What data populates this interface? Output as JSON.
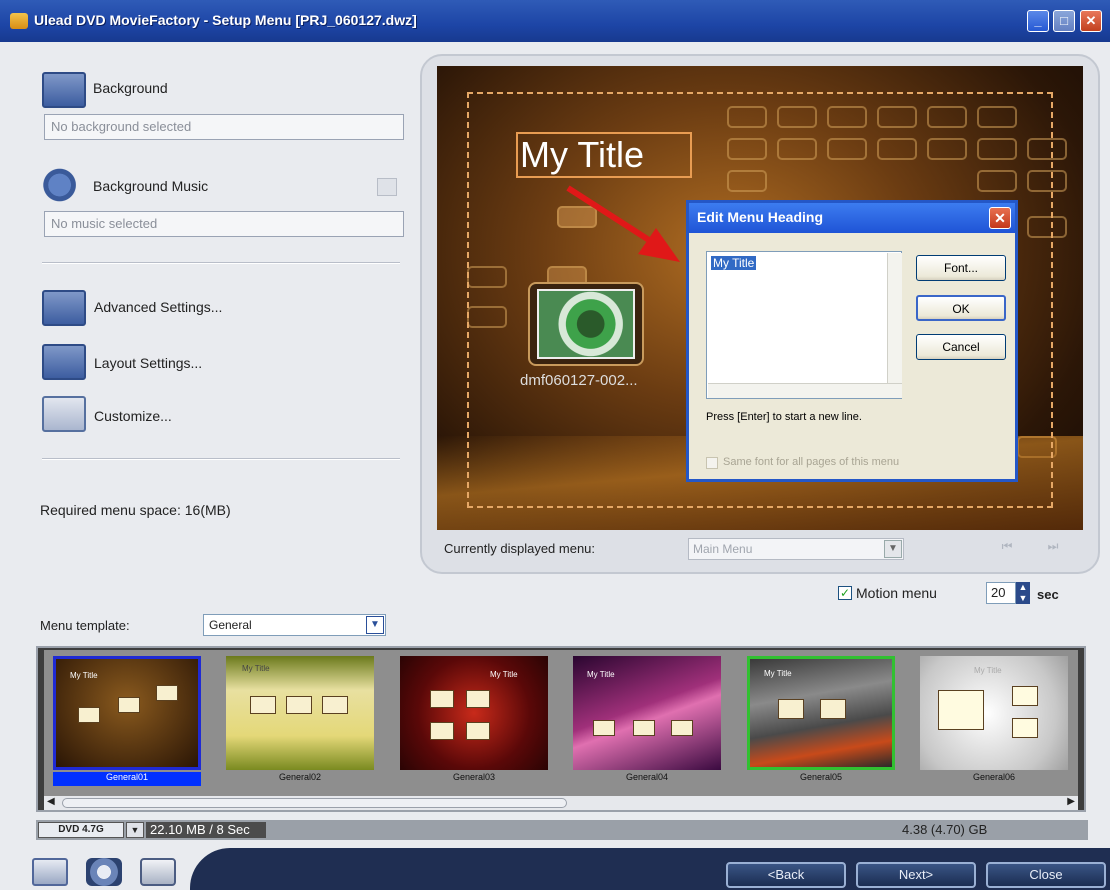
{
  "window": {
    "title": "Ulead DVD MovieFactory - Setup Menu [PRJ_060127.dwz]"
  },
  "left": {
    "background_label": "Background",
    "background_value": "No background selected",
    "music_label": "Background Music",
    "music_value": "No music selected",
    "advanced_label": "Advanced Settings...",
    "layout_label": "Layout Settings...",
    "customize_label": "Customize...",
    "required_space": "Required menu space: 16(MB)"
  },
  "preview": {
    "title_text": "My Title",
    "thumb_caption": "dmf060127-002...",
    "displayed_menu_label": "Currently displayed menu:",
    "displayed_menu_value": "Main Menu",
    "motion_menu_label": "Motion menu",
    "motion_menu_checked": true,
    "seconds_value": "20",
    "seconds_unit": "sec"
  },
  "dialog": {
    "title": "Edit Menu Heading",
    "text_value": "My Title",
    "font_button": "Font...",
    "ok_button": "OK",
    "cancel_button": "Cancel",
    "hint": "Press [Enter] to start a new line.",
    "save_font_label": "Same font for all pages of this menu"
  },
  "templates": {
    "label": "Menu template:",
    "category": "General",
    "items": [
      {
        "caption": "General01",
        "title": "My Title"
      },
      {
        "caption": "General02",
        "title": "My Title"
      },
      {
        "caption": "General03",
        "title": "My Title"
      },
      {
        "caption": "General04",
        "title": "My Title"
      },
      {
        "caption": "General05",
        "title": "My Title"
      },
      {
        "caption": "General06",
        "title": "My Title"
      }
    ]
  },
  "status": {
    "disc_type": "DVD 4.7G",
    "used": "22.10 MB / 8 Sec",
    "capacity": "4.38 (4.70) GB"
  },
  "buttons": {
    "back": "<Back",
    "next": "Next>",
    "close": "Close"
  },
  "colors": {
    "titlebar": "#1d45a6",
    "selection": "#0030ff",
    "dialog_title": "#1f54d6",
    "bottom_bar": "#1f2e52"
  }
}
